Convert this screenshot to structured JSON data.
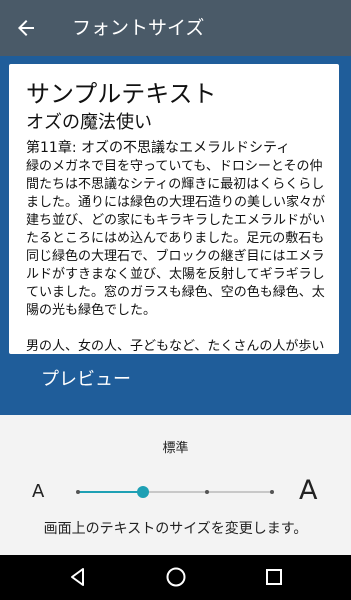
{
  "header": {
    "title": "フォントサイズ",
    "back_icon": "arrow-left-icon"
  },
  "preview": {
    "sample_title": "サンプルテキスト",
    "book_title": "オズの魔法使い",
    "chapter": "第11章: オズの不思議なエメラルドシティ",
    "paragraph1": "緑のメガネで目を守っていても、ドロシーとその仲間たちは不思議なシティの輝きに最初はくらくらしました。通りには緑色の大理石造りの美しい家々が建ち並び、どの家にもキラキラしたエメラルドがいたるところにはめ込んでありました。足元の敷石も同じ緑色の大理石で、ブロックの継ぎ目にはエメラルドがすきまなく並び、太陽を反射してギラギラしていました。窓のガラスも緑色、空の色も緑色、太陽の光も緑色でした。",
    "paragraph2": "男の人、女の人、子どもなど、たくさんの人が歩いていて、だれもかれも緑色の服を着て、肌の色も緑がかっていました。みんなドロシーとその奇妙な仲間たちを不思議そうに見つめました。",
    "label": "プレビュー"
  },
  "font_size": {
    "current_label": "標準",
    "small_glyph": "A",
    "large_glyph": "A",
    "levels": 4,
    "selected_level_index": 1,
    "description": "画面上のテキストのサイズを変更します。"
  },
  "navbar": {
    "icons": [
      "back-triangle-icon",
      "home-circle-icon",
      "recents-square-icon"
    ]
  },
  "colors": {
    "toolbar": "#4a5a68",
    "preview_background": "#1f5d9a",
    "accent": "#1ea0b4"
  }
}
